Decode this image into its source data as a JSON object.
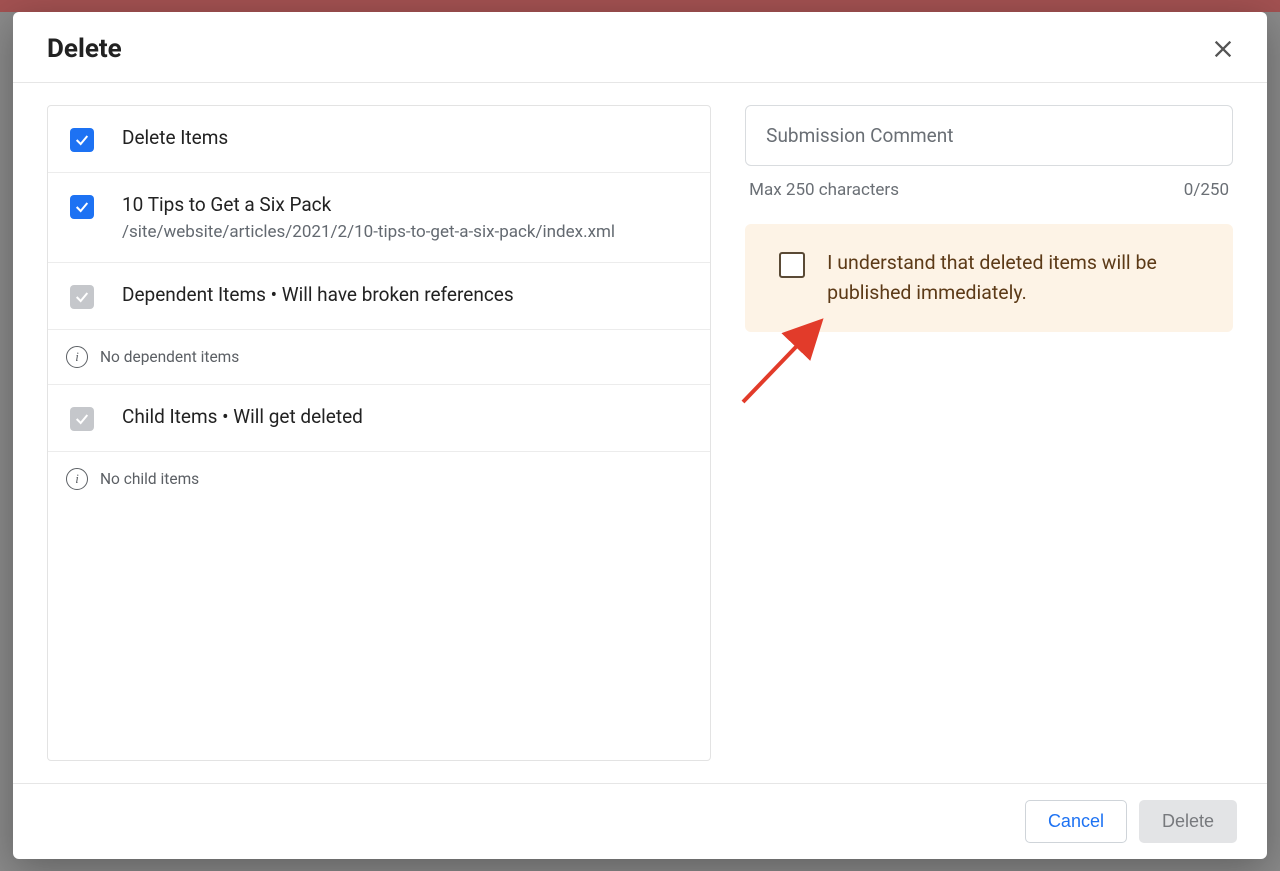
{
  "dialog": {
    "title": "Delete",
    "footer": {
      "cancel": "Cancel",
      "delete": "Delete"
    }
  },
  "left": {
    "delete_items_label": "Delete Items",
    "item": {
      "title": "10 Tips to Get a Six Pack",
      "path": "/site/website/articles/2021/2/10-tips-to-get-a-six-pack/index.xml"
    },
    "dependent": {
      "label": "Dependent Items • Will have broken references",
      "empty": "No dependent items"
    },
    "child": {
      "label": "Child Items • Will get deleted",
      "empty": "No child items"
    }
  },
  "right": {
    "comment_placeholder": "Submission Comment",
    "char_hint": "Max 250 characters",
    "char_count": "0/250",
    "acknowledge": "I understand that deleted items will be published immediately."
  }
}
